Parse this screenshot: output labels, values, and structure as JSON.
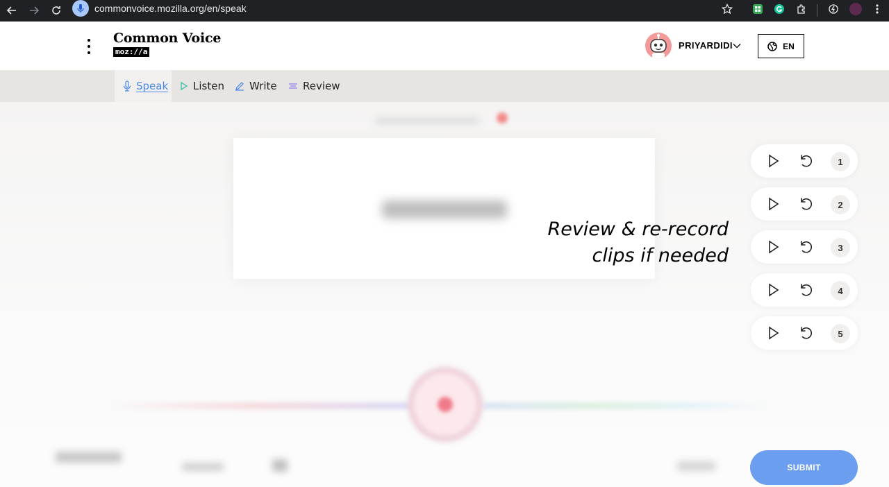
{
  "browser": {
    "url": "commonvoice.mozilla.org/en/speak"
  },
  "header": {
    "logo_title": "Common Voice",
    "logo_sub": "moz://a",
    "username": "PRIYARDIDI",
    "language": "EN"
  },
  "tabs": [
    {
      "label": "Speak",
      "icon": "microphone-icon",
      "active": true
    },
    {
      "label": "Listen",
      "icon": "play-icon",
      "active": false
    },
    {
      "label": "Write",
      "icon": "pencil-icon",
      "active": false
    },
    {
      "label": "Review",
      "icon": "lines-icon",
      "active": false
    }
  ],
  "hint": {
    "line1": "Review & re-record",
    "line2": "clips if needed"
  },
  "clips": [
    {
      "number": "1"
    },
    {
      "number": "2"
    },
    {
      "number": "3"
    },
    {
      "number": "4"
    },
    {
      "number": "5"
    }
  ],
  "actions": {
    "submit_label": "SUBMIT"
  },
  "colors": {
    "accent": "#4a88e9",
    "submit": "#6c9ef0",
    "tabbar": "#e7e5e2"
  }
}
